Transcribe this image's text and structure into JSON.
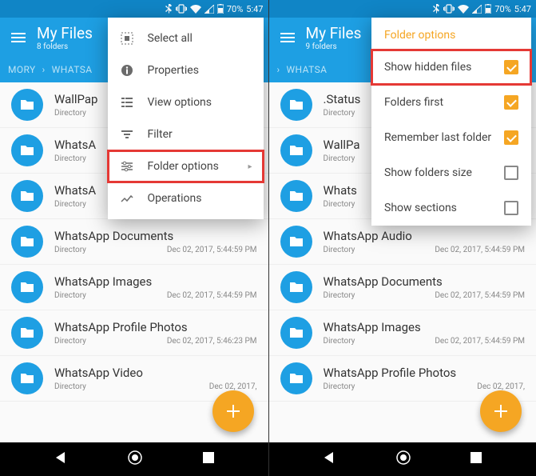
{
  "status": {
    "battery": "70%",
    "time": "5:47"
  },
  "left": {
    "title": "My Files",
    "subtitle": "8 folders",
    "breadcrumb1": "MORY",
    "breadcrumb2": "WHATSA",
    "rows": [
      {
        "name": "WallPap",
        "type": "Directory",
        "date": ""
      },
      {
        "name": "WhatsA",
        "type": "Directory",
        "date": ""
      },
      {
        "name": "WhatsA",
        "type": "Directory",
        "date": ""
      },
      {
        "name": "WhatsApp Documents",
        "type": "Directory",
        "date": "Dec 02, 2017, 5:44:59 PM"
      },
      {
        "name": "WhatsApp Images",
        "type": "Directory",
        "date": "Dec 02, 2017, 5:44:59 PM"
      },
      {
        "name": "WhatsApp Profile Photos",
        "type": "Directory",
        "date": "Dec 02, 2017, 5:46:23 PM"
      },
      {
        "name": "WhatsApp Video",
        "type": "Directory",
        "date": "Dec 02, 2017,"
      }
    ],
    "menu": {
      "select_all": "Select all",
      "properties": "Properties",
      "view_options": "View options",
      "filter": "Filter",
      "folder_options": "Folder options",
      "operations": "Operations"
    }
  },
  "right": {
    "title": "My Files",
    "subtitle": "9 folders",
    "breadcrumb2": "WHATSA",
    "rows": [
      {
        "name": ".Status",
        "type": "Directory",
        "date": ""
      },
      {
        "name": "WallPa",
        "type": "Directory",
        "date": ""
      },
      {
        "name": "Whats",
        "type": "Directory",
        "date": ""
      },
      {
        "name": "WhatsApp Audio",
        "type": "Directory",
        "date": "Dec 02, 2017, 5:44:59 PM"
      },
      {
        "name": "WhatsApp Documents",
        "type": "Directory",
        "date": "Dec 02, 2017, 5:44:59 PM"
      },
      {
        "name": "WhatsApp Images",
        "type": "Directory",
        "date": "Dec 02, 2017, 5:44:59 PM"
      },
      {
        "name": "WhatsApp Profile Photos",
        "type": "Directory",
        "date": "Dec 02, 2017,"
      }
    ],
    "folder_options": {
      "title": "Folder options",
      "show_hidden": "Show hidden files",
      "folders_first": "Folders first",
      "remember": "Remember last folder",
      "show_size": "Show folders size",
      "sections": "Show sections"
    }
  }
}
